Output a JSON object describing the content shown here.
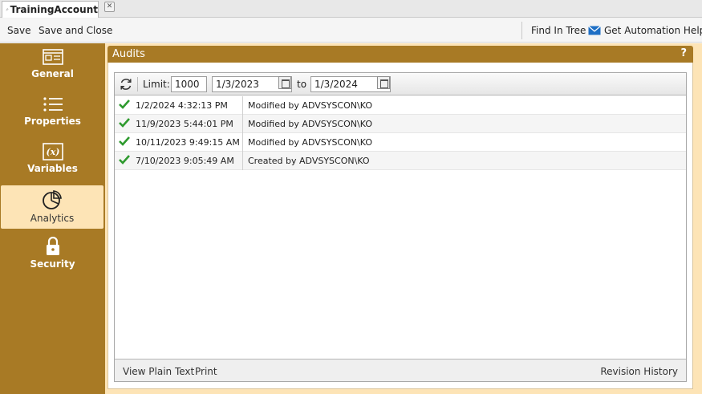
{
  "tab": {
    "title": "TrainingAccount",
    "close": "✕"
  },
  "toolbar": {
    "save": "Save",
    "save_close": "Save and Close",
    "find_in_tree": "Find In Tree",
    "automation_help": "Get Automation Help..."
  },
  "sidebar": {
    "items": [
      {
        "label": "General",
        "icon": "form-icon"
      },
      {
        "label": "Properties",
        "icon": "list-icon"
      },
      {
        "label": "Variables",
        "icon": "variable-icon"
      },
      {
        "label": "Analytics",
        "icon": "pie-chart-icon",
        "active": true
      },
      {
        "label": "Security",
        "icon": "lock-icon"
      }
    ]
  },
  "panel": {
    "title": "Audits",
    "help": "?",
    "filter": {
      "limit_label": "Limit:",
      "limit_value": "1000",
      "from_date": "1/3/2023",
      "to_label": "to",
      "to_date": "1/3/2024"
    },
    "rows": [
      {
        "timestamp": "1/2/2024 4:32:13 PM",
        "description": "Modified by ADVSYSCON\\KO"
      },
      {
        "timestamp": "11/9/2023 5:44:01 PM",
        "description": "Modified by ADVSYSCON\\KO"
      },
      {
        "timestamp": "10/11/2023 9:49:15 AM",
        "description": "Modified by ADVSYSCON\\KO"
      },
      {
        "timestamp": "7/10/2023 9:05:49 AM",
        "description": "Created by ADVSYSCON\\KO"
      }
    ],
    "footer": {
      "view_plain_text": "View Plain Text",
      "print": "Print",
      "revision_history": "Revision History"
    }
  },
  "colors": {
    "accent": "#a87a25",
    "active_bg": "#fde4b6",
    "check": "#2e9a2e",
    "mail_icon": "#1e6fc5"
  }
}
